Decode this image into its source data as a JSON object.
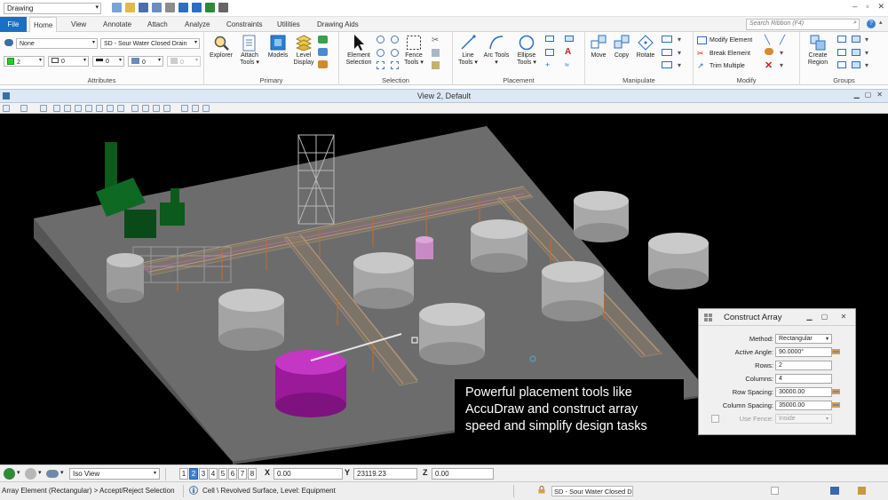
{
  "titlebar": {
    "workspace": "Drawing",
    "window_controls": [
      "–",
      "▫",
      "✕"
    ]
  },
  "tabs": {
    "file": "File",
    "items": [
      "Home",
      "View",
      "Annotate",
      "Attach",
      "Analyze",
      "Constraints",
      "Utilities",
      "Drawing Aids"
    ],
    "active": "Home",
    "search_placeholder": "Search Ribbon (F4)"
  },
  "ribbon": {
    "attributes": {
      "label": "Attributes",
      "level_combo": "None",
      "style_combo": "SD - Sour Water Closed Drain",
      "color_value": "2",
      "style_value": "0",
      "weight_value": "0",
      "transparency_value": "0",
      "priority_value": "0"
    },
    "primary": {
      "label": "Primary",
      "buttons": [
        "Explorer",
        "Attach Tools",
        "Models",
        "Level Display"
      ]
    },
    "selection": {
      "label": "Selection",
      "buttons": [
        "Element Selection",
        "Fence Tools"
      ]
    },
    "placement": {
      "label": "Placement",
      "buttons": [
        "Line Tools",
        "Arc Tools",
        "Ellipse Tools"
      ]
    },
    "manipulate": {
      "label": "Manipulate",
      "buttons": [
        "Move",
        "Copy",
        "Rotate"
      ]
    },
    "modify": {
      "label": "Modify",
      "items": [
        "Modify Element",
        "Break Element",
        "Trim Multiple"
      ]
    },
    "groups": {
      "label": "Groups",
      "buttons": [
        "Create Region"
      ]
    }
  },
  "view": {
    "title": "View 2, Default"
  },
  "caption": {
    "lines": [
      "Powerful placement tools like",
      "AccuDraw and construct array",
      "speed and simplify design tasks"
    ]
  },
  "dialog": {
    "title": "Construct Array",
    "fields": [
      {
        "label": "Method:",
        "value": "Rectangular",
        "dropdown": true
      },
      {
        "label": "Active Angle:",
        "value": "90.0000°",
        "lock": true
      },
      {
        "label": "Rows:",
        "value": "2"
      },
      {
        "label": "Columns:",
        "value": "4"
      },
      {
        "label": "Row Spacing:",
        "value": "30000.00",
        "lock": true
      },
      {
        "label": "Column Spacing:",
        "value": "35000.00",
        "lock": true
      }
    ],
    "use_fence_label": "Use Fence:",
    "use_fence_value": "Inside"
  },
  "statusbar": {
    "view_combo": "Iso View",
    "view_numbers": [
      "1",
      "2",
      "3",
      "4",
      "5",
      "6",
      "7",
      "8"
    ],
    "active_view": "2",
    "x_label": "X",
    "x_value": "0.00",
    "y_label": "Y",
    "y_value": "23119.23",
    "z_label": "Z",
    "z_value": "0.00",
    "prompt": "Array Element (Rectangular) > Accept/Reject Selection",
    "info": "Cell \\ Revolved Surface, Level: Equipment",
    "level": "SD - Sour Water Closed D"
  },
  "colors": {
    "accent": "#1a6fc2",
    "tank_gray": "#b7b7b7",
    "tank_magenta": "#b21fb2",
    "equipment_green": "#0c5a1c",
    "ground": "#6e6e6e"
  }
}
